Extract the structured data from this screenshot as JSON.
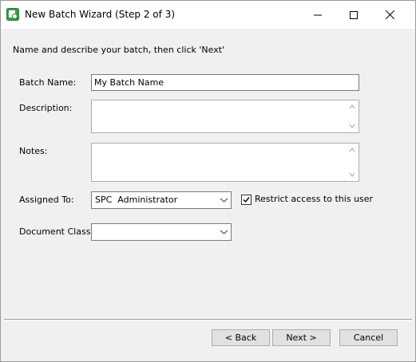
{
  "window": {
    "title": "New Batch Wizard (Step 2 of 3)",
    "controls": {
      "minimize_icon": "minimize-icon",
      "maximize_icon": "maximize-icon",
      "close_icon": "close-icon"
    }
  },
  "instruction": "Name and describe your batch, then click 'Next'",
  "form": {
    "batch_name": {
      "label": "Batch Name:",
      "value": "My Batch Name"
    },
    "description": {
      "label": "Description:",
      "value": ""
    },
    "notes": {
      "label": "Notes:",
      "value": ""
    },
    "assigned_to": {
      "label": "Assigned To:",
      "value": "SPC  Administrator"
    },
    "restrict": {
      "label": "Restrict access to this user",
      "checked": true
    },
    "document_class": {
      "label": "Document Class:",
      "value": ""
    }
  },
  "buttons": {
    "back": "< Back",
    "next": "Next >",
    "cancel": "Cancel"
  },
  "colors": {
    "icon_green": "#3a9a4a",
    "window_bg": "#f0f0f0",
    "button_bg": "#e1e1e1"
  }
}
